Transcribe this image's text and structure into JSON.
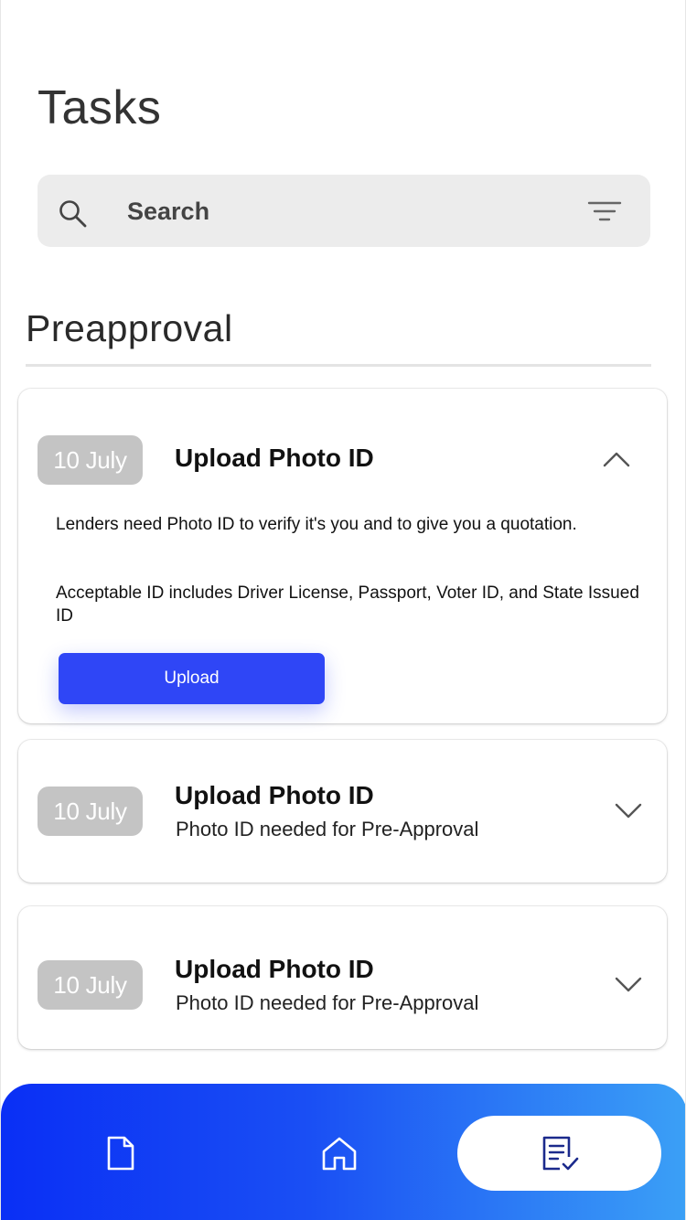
{
  "header": {
    "title": "Tasks"
  },
  "search": {
    "placeholder": "Search",
    "value": ""
  },
  "section": {
    "title": "Preapproval"
  },
  "tasks": [
    {
      "date": "10 July",
      "title": "Upload Photo ID",
      "expanded": true,
      "description_1": "Lenders need Photo ID to verify it's you and to give you a quotation.",
      "description_2": "Acceptable ID includes Driver License, Passport, Voter ID, and State Issued ID",
      "action_label": "Upload"
    },
    {
      "date": "10 July",
      "title": "Upload Photo ID",
      "subtitle": "Photo ID needed for Pre-Approval",
      "expanded": false
    },
    {
      "date": "10 July",
      "title": "Upload Photo ID",
      "subtitle": "Photo ID needed for Pre-Approval",
      "expanded": false
    }
  ],
  "bottom_nav": {
    "items": [
      {
        "icon": "document-icon",
        "active": false
      },
      {
        "icon": "home-icon",
        "active": false
      },
      {
        "icon": "task-list-icon",
        "active": true
      }
    ],
    "gradient_start": "#0a2ff5",
    "gradient_end": "#3ba0f6"
  },
  "colors": {
    "accent": "#2f46f6",
    "badge": "#c4c4c4",
    "search_background": "#ececec",
    "active_icon": "#1b2a8c"
  }
}
